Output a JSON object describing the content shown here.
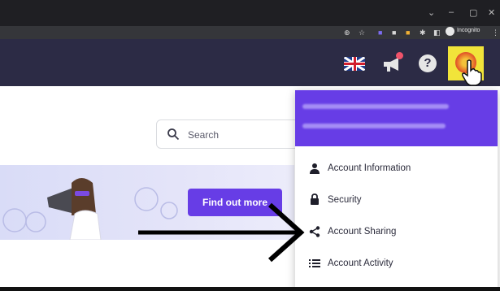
{
  "browser": {
    "window_controls": [
      "⌄",
      "–",
      "▢",
      "✕"
    ],
    "incognito_label": "Incognito"
  },
  "header": {
    "language_flag": "uk-flag-icon",
    "help_label": "?"
  },
  "search": {
    "placeholder": "Search"
  },
  "banner": {
    "cta_label": "Find out more"
  },
  "account_menu": {
    "items": [
      {
        "label": "Account Information",
        "icon": "person-icon"
      },
      {
        "label": "Security",
        "icon": "lock-icon"
      },
      {
        "label": "Account Sharing",
        "icon": "share-icon"
      },
      {
        "label": "Account Activity",
        "icon": "list-icon"
      }
    ]
  },
  "colors": {
    "brand": "#673de6",
    "header_bg": "#2c2b45",
    "highlight": "#f1e43a"
  }
}
